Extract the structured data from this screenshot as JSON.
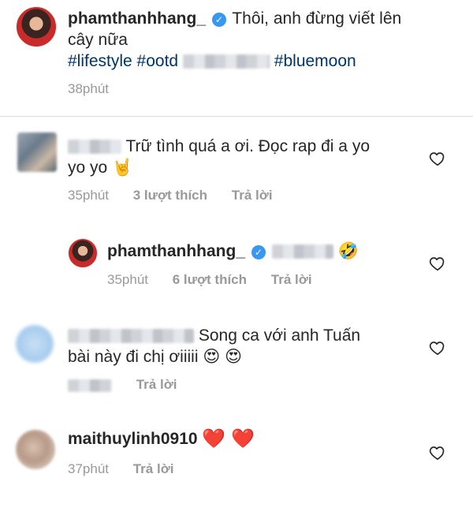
{
  "post": {
    "username": "phamthanhhang_",
    "caption_line1": "Thôi, anh đừng viết lên",
    "caption_line2": "cây nữa",
    "tag1": "#lifestyle",
    "tag2": "#ootd",
    "tag3": "#bluemoon",
    "time": "38phút"
  },
  "comments": [
    {
      "text_line1": "Trữ tình quá a ơi. Đọc rap đi a yo",
      "text_line2": "yo yo",
      "emoji": "🤘",
      "time": "35phút",
      "likes": "3 lượt thích",
      "reply": "Trả lời"
    },
    {
      "username": "phamthanhhang_",
      "emoji": "🤣",
      "time": "35phút",
      "likes": "6 lượt thích",
      "reply": "Trả lời"
    },
    {
      "text_line1": "Song ca với anh Tuấn",
      "text_line2": "bài này đi chị ơiiiii",
      "emoji": "😍 😍",
      "reply": "Trả lời"
    },
    {
      "username": "maithuylinh0910",
      "emoji": "❤️ ❤️",
      "time": "37phút",
      "reply": "Trả lời"
    }
  ],
  "icons": {
    "verified": "verified-badge-icon",
    "like": "heart-outline-icon"
  }
}
